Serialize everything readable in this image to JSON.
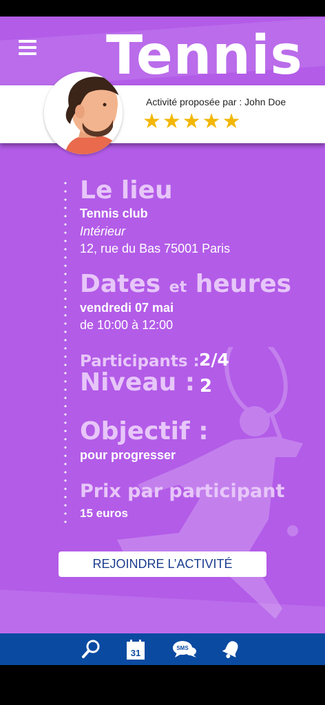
{
  "header": {
    "title": "Tennis",
    "proposer_label": "Activité proposée par : John Doe",
    "rating_stars": "★★★★★",
    "rating": 5
  },
  "lieu": {
    "heading": "Le lieu",
    "name": "Tennis club",
    "type": "Intérieur",
    "address": "12, rue du Bas 75001 Paris"
  },
  "dates": {
    "heading_a": "Dates",
    "heading_b": "et",
    "heading_c": "heures",
    "day": "vendredi 07 mai",
    "time": "de 10:00 à 12:00"
  },
  "participants": {
    "label": "Participants :",
    "value": "2/4"
  },
  "niveau": {
    "label": "Niveau :",
    "value": "2"
  },
  "objectif": {
    "heading": "Objectif :",
    "value": "pour progresser"
  },
  "prix": {
    "heading": "Prix par participant",
    "value": "15 euros"
  },
  "join_button": "REJOINDRE L’ACTIVITÉ",
  "bottom_nav": {
    "calendar_day": "31",
    "sms_label": "SMS",
    "items": [
      "search-icon",
      "calendar-icon",
      "sms-icon",
      "notification-bell-icon"
    ]
  },
  "colors": {
    "background": "#b35ce8",
    "heading": "#e7c6f9",
    "star": "#f2b705",
    "nav_bar": "#0a4aa1",
    "button_text": "#1b3d8f"
  }
}
